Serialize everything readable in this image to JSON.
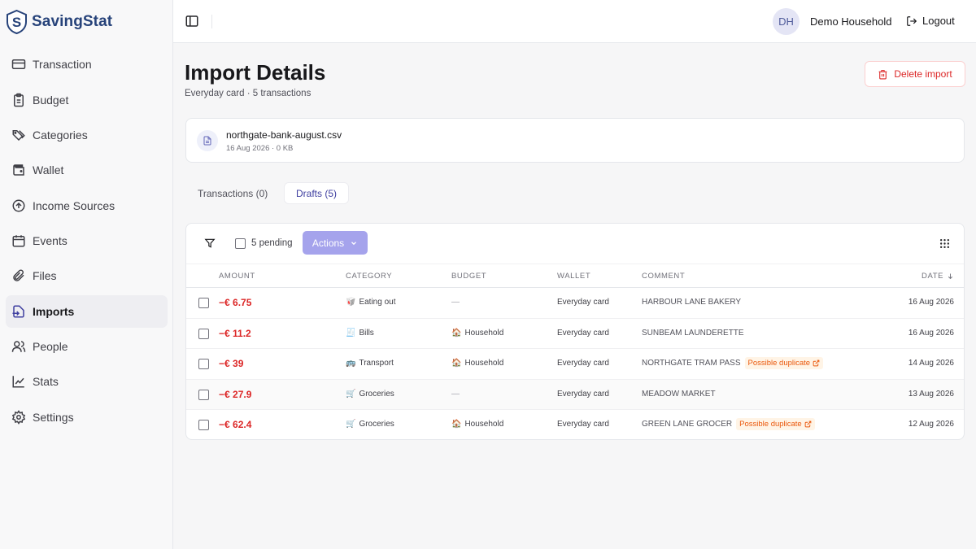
{
  "brand": {
    "name": "SavingStat"
  },
  "nav": [
    {
      "label": "Transaction",
      "icon": "credit-card-icon"
    },
    {
      "label": "Budget",
      "icon": "clipboard-icon"
    },
    {
      "label": "Categories",
      "icon": "tags-icon"
    },
    {
      "label": "Wallet",
      "icon": "wallet-icon"
    },
    {
      "label": "Income Sources",
      "icon": "arrow-up-circle-icon"
    },
    {
      "label": "Events",
      "icon": "calendar-icon"
    },
    {
      "label": "Files",
      "icon": "paperclip-icon"
    },
    {
      "label": "Imports",
      "icon": "import-icon",
      "active": true
    },
    {
      "label": "People",
      "icon": "users-icon"
    },
    {
      "label": "Stats",
      "icon": "chart-icon"
    },
    {
      "label": "Settings",
      "icon": "gear-icon"
    }
  ],
  "header": {
    "avatar_initials": "DH",
    "household": "Demo Household",
    "logout_label": "Logout"
  },
  "page": {
    "title": "Import Details",
    "subtitle": "Everyday card · 5 transactions",
    "delete_label": "Delete import"
  },
  "file": {
    "name": "northgate-bank-august.csv",
    "meta": "16 Aug 2026 · 0 KB"
  },
  "tabs": [
    {
      "label": "Transactions (0)"
    },
    {
      "label": "Drafts (5)",
      "active": true
    }
  ],
  "toolbar": {
    "pending_label": "5 pending",
    "actions_label": "Actions"
  },
  "columns": {
    "amount": "AMOUNT",
    "category": "CATEGORY",
    "budget": "BUDGET",
    "wallet": "WALLET",
    "comment": "COMMENT",
    "date": "DATE"
  },
  "rows": [
    {
      "amount": "−€ 6.75",
      "category": "Eating out",
      "category_icon": "🥡",
      "budget": "—",
      "budget_icon": "",
      "wallet": "Everyday card",
      "comment": "HARBOUR LANE BAKERY",
      "duplicate": "",
      "date": "16 Aug 2026"
    },
    {
      "amount": "−€ 11.2",
      "category": "Bills",
      "category_icon": "🧾",
      "budget": "Household",
      "budget_icon": "🏠",
      "wallet": "Everyday card",
      "comment": "SUNBEAM LAUNDERETTE",
      "duplicate": "",
      "date": "16 Aug 2026"
    },
    {
      "amount": "−€ 39",
      "category": "Transport",
      "category_icon": "🚌",
      "budget": "Household",
      "budget_icon": "🏠",
      "wallet": "Everyday card",
      "comment": "NORTHGATE TRAM PASS",
      "duplicate": "Possible duplicate",
      "date": "14 Aug 2026"
    },
    {
      "amount": "−€ 27.9",
      "category": "Groceries",
      "category_icon": "🛒",
      "budget": "—",
      "budget_icon": "",
      "wallet": "Everyday card",
      "comment": "MEADOW MARKET",
      "duplicate": "",
      "date": "13 Aug 2026"
    },
    {
      "amount": "−€ 62.4",
      "category": "Groceries",
      "category_icon": "🛒",
      "budget": "Household",
      "budget_icon": "🏠",
      "wallet": "Everyday card",
      "comment": "GREEN LANE GROCER",
      "duplicate": "Possible duplicate",
      "date": "12 Aug 2026"
    }
  ],
  "colors": {
    "accent": "#3f3fa0",
    "negative": "#dc2626",
    "actions_bg": "#a5a3ec",
    "brand": "#27437a",
    "warning": "#ea580c"
  }
}
